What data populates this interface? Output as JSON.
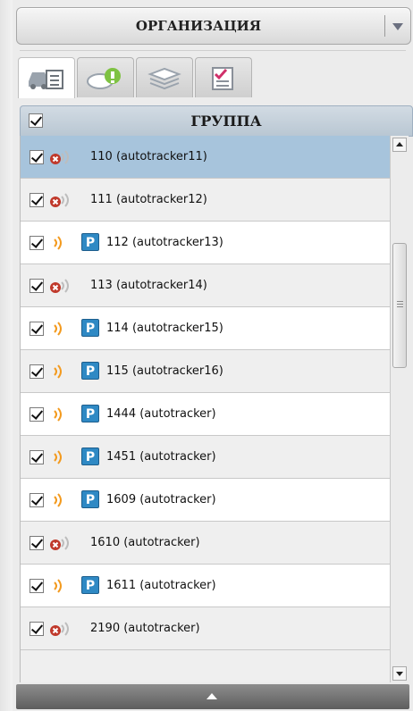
{
  "header": {
    "title": "ОРГАНИЗАЦИЯ"
  },
  "tabs": [
    {
      "name": "vehicles",
      "icon": "car-list-icon"
    },
    {
      "name": "geozones",
      "icon": "map-lightbulb-icon"
    },
    {
      "name": "layers",
      "icon": "layers-icon"
    },
    {
      "name": "reports",
      "icon": "checklist-icon"
    }
  ],
  "group": {
    "title": "ГРУППА",
    "checked": true
  },
  "units": [
    {
      "label": "110 (autotracker11)",
      "status": "offline",
      "parked": false,
      "selected": true
    },
    {
      "label": "111 (autotracker12)",
      "status": "offline",
      "parked": false
    },
    {
      "label": "112 (autotracker13)",
      "status": "online",
      "parked": true
    },
    {
      "label": "113 (autotracker14)",
      "status": "offline",
      "parked": false
    },
    {
      "label": "114 (autotracker15)",
      "status": "online",
      "parked": true
    },
    {
      "label": "115 (autotracker16)",
      "status": "online",
      "parked": true
    },
    {
      "label": "1444 (autotracker)",
      "status": "online",
      "parked": true
    },
    {
      "label": "1451 (autotracker)",
      "status": "online",
      "parked": true
    },
    {
      "label": "1609 (autotracker)",
      "status": "online",
      "parked": true
    },
    {
      "label": "1610 (autotracker)",
      "status": "offline",
      "parked": false
    },
    {
      "label": "1611 (autotracker)",
      "status": "online",
      "parked": true
    },
    {
      "label": "2190 (autotracker)",
      "status": "offline",
      "parked": false
    }
  ],
  "badge_letter": "P",
  "colors": {
    "selected_row": "#a7c4dc",
    "signal_online": "#f39a1e",
    "signal_offline": "#bdbdbd",
    "error": "#c0392b",
    "parking": "#2f89c4"
  }
}
